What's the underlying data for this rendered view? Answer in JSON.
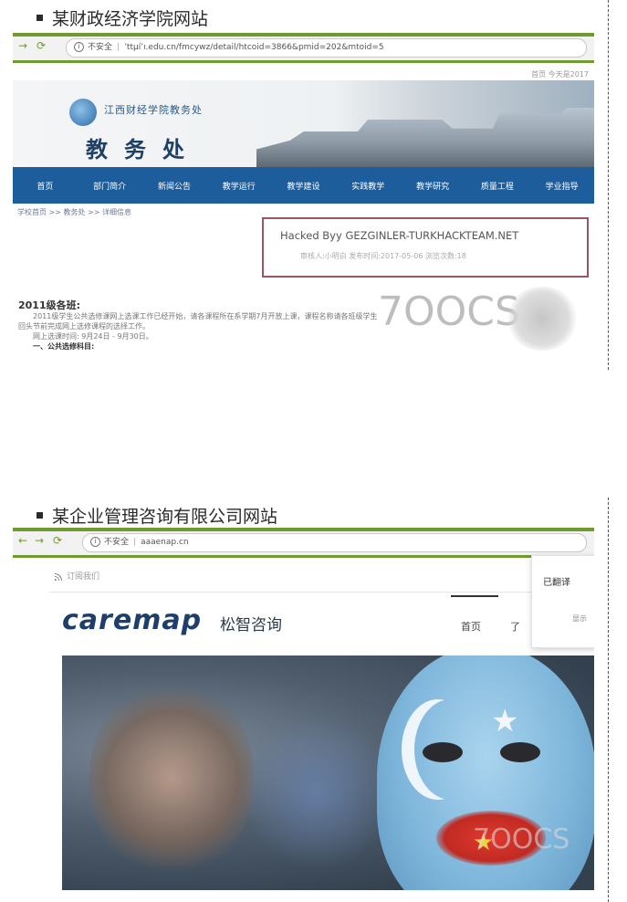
{
  "section1": {
    "title": "某财政经济学院网站",
    "browser": {
      "security": "不安全",
      "url": "’ttµí’ı.edu.cn/fmcywz/detail/htcoid=3866&pmid=202&mtoid=5"
    },
    "site": {
      "date_text": "首页  今天是2017",
      "school_name": "江西财经学院教务处",
      "dept_name": "教务处",
      "nav": [
        "首页",
        "部门简介",
        "新闻公告",
        "教学运行",
        "教学建设",
        "实践教学",
        "教学研究",
        "质量工程",
        "学业指导"
      ],
      "breadcrumb": "学校首页 >> 教务处 >> 详细信息",
      "hacked_title": "Hacked Byy GEZGINLER-TURKHACKTEAM.NET",
      "hacked_meta": "审核人:小明白  发布时间:2017-05-06  浏览次数:18",
      "notice_title": "2011级各班:",
      "notice_lines": [
        "2011级学生公共选修课网上选课工作已经开始，请各课程所在系学期7月开放上课，课程名称请各班级学生",
        "回头节前完成网上选修课程的选择工作。",
        "网上选课时间: 9月24日 - 9月30日。",
        "一、公共选修科目:"
      ],
      "watermark": "7OOCS"
    }
  },
  "section2": {
    "title": "某企业管理咨询有限公司网站",
    "browser": {
      "security": "不安全",
      "url": "aaaenap.cn"
    },
    "site": {
      "rss_text": "订阅我们",
      "logo": "caremap",
      "logo_cn": "松智咨询",
      "nav_home": "首页",
      "nav_more": "了",
      "translate_title": "已翻译",
      "translate_action": "显示",
      "watermark": "7OOCS"
    }
  },
  "colors": {
    "nav_blue": "#1e5d9c",
    "browser_green": "#6f9a2f",
    "hacked_border": "#9b5560"
  }
}
